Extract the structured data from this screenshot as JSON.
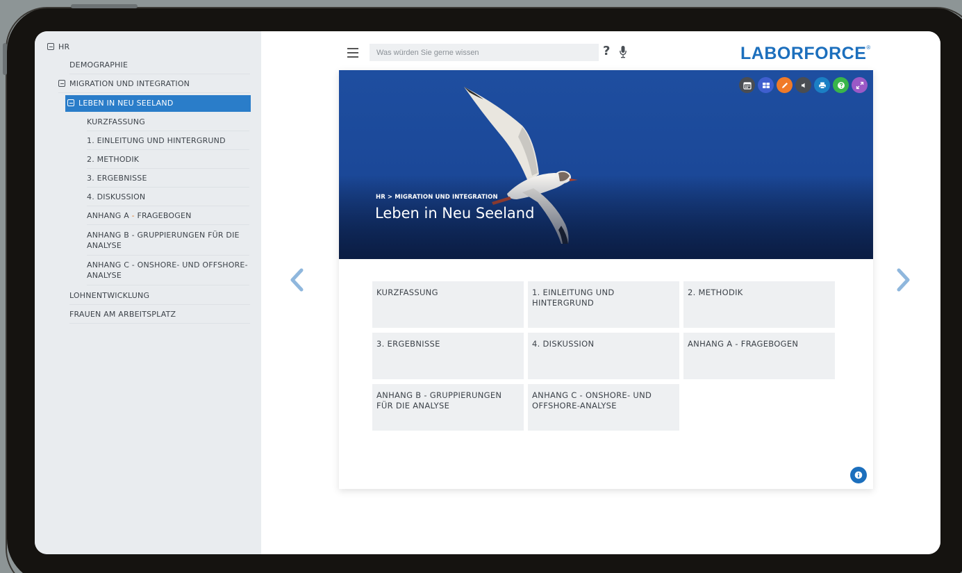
{
  "sidebar": {
    "items": [
      {
        "label": "HR"
      },
      {
        "label": "DEMOGRAPHIE"
      },
      {
        "label": "MIGRATION UND INTEGRATION"
      },
      {
        "label": "LEBEN IN NEU SEELAND"
      },
      {
        "label": "KURZFASSUNG"
      },
      {
        "label": "1. EINLEITUNG UND HINTERGRUND"
      },
      {
        "label": "2. METHODIK"
      },
      {
        "label": "3. ERGEBNISSE"
      },
      {
        "label": "4. DISKUSSION"
      },
      {
        "label_prefix": "ANHANG A ",
        "label_dash": "-",
        "label_suffix": " FRAGEBOGEN"
      },
      {
        "label": "ANHANG B - GRUPPIERUNGEN FÜR DIE ANALYSE"
      },
      {
        "label": "ANHANG C - ONSHORE- UND OFFSHORE-ANALYSE"
      },
      {
        "label": "LOHNENTWICKLUNG"
      },
      {
        "label": "FRAUEN AM ARBEITSPLATZ"
      }
    ]
  },
  "header": {
    "search_placeholder": "Was würden Sie gerne wissen",
    "help_symbol": "?",
    "logo_text": "LABORFORCE",
    "logo_mark": "®"
  },
  "hero": {
    "breadcrumb": "HR > MIGRATION UND INTEGRATION",
    "title": "Leben in Neu Seeland"
  },
  "toolbar": {
    "buttons": [
      {
        "icon": "calendar-icon",
        "color": "#4a4d52"
      },
      {
        "icon": "grid-icon",
        "color": "#3f5fcf"
      },
      {
        "icon": "pencil-icon",
        "color": "#f07a28"
      },
      {
        "icon": "speaker-icon",
        "color": "#4a4d52"
      },
      {
        "icon": "print-icon",
        "color": "#1b7fc4"
      },
      {
        "icon": "help-icon",
        "color": "#39b54a"
      },
      {
        "icon": "expand-icon",
        "color": "#9b59c6"
      }
    ]
  },
  "tiles": [
    {
      "label": "KURZFASSUNG"
    },
    {
      "label": "1. EINLEITUNG UND HINTERGRUND"
    },
    {
      "label": "2. METHODIK"
    },
    {
      "label": "3. ERGEBNISSE"
    },
    {
      "label": "4. DISKUSSION"
    },
    {
      "label": "ANHANG A - FRAGEBOGEN"
    },
    {
      "label": "ANHANG B - GRUPPIERUNGEN FÜR DIE ANALYSE"
    },
    {
      "label": "ANHANG C - ONSHORE- UND OFFSHORE-ANALYSE"
    }
  ],
  "colors": {
    "accent": "#1c6fbd",
    "active_item": "#2a7dc9",
    "nav_arrow": "#8fb7dd"
  }
}
